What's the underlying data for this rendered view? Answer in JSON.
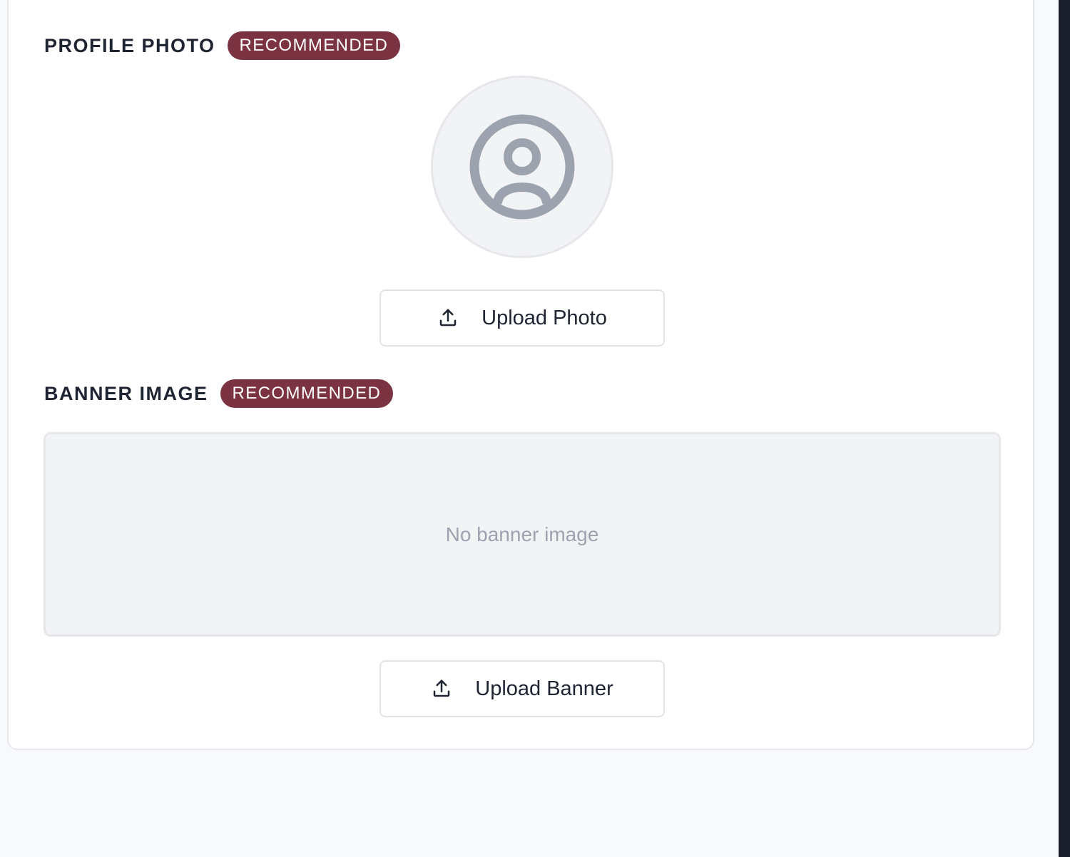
{
  "profile_photo": {
    "title": "PROFILE PHOTO",
    "badge": "RECOMMENDED",
    "avatar_icon": "user-circle-icon",
    "upload_label": "Upload Photo",
    "upload_icon": "upload-icon"
  },
  "banner_image": {
    "title": "BANNER IMAGE",
    "badge": "RECOMMENDED",
    "placeholder": "No banner image",
    "upload_label": "Upload Banner",
    "upload_icon": "upload-icon"
  },
  "colors": {
    "badge_background": "#7b3342",
    "title_text": "#1f2433",
    "placeholder_text": "#9ca3af",
    "card_background": "#ffffff",
    "page_background": "#f8f9fb",
    "avatar_icon": "#9ca3af"
  }
}
